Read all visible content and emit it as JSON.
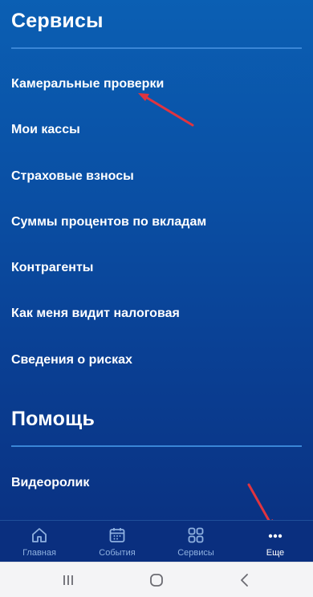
{
  "colors": {
    "background_top": "#0b5fb3",
    "background_bottom": "#0a2f7f",
    "divider": "#3a86d6",
    "tab_inactive": "#8fb1e0",
    "tab_active": "#ffffff",
    "annotation_arrow": "#e0343f"
  },
  "services": {
    "title": "Сервисы",
    "items": [
      {
        "label": "Камеральные проверки"
      },
      {
        "label": "Мои кассы"
      },
      {
        "label": "Страховые взносы"
      },
      {
        "label": "Суммы процентов по вкладам"
      },
      {
        "label": "Контрагенты"
      },
      {
        "label": "Как меня видит налоговая"
      },
      {
        "label": "Сведения о рисках"
      }
    ]
  },
  "help": {
    "title": "Помощь",
    "items": [
      {
        "label": "Видеоролик"
      }
    ]
  },
  "tabbar": {
    "tabs": [
      {
        "label": "Главная",
        "icon": "home-icon",
        "active": false
      },
      {
        "label": "События",
        "icon": "calendar-icon",
        "active": false
      },
      {
        "label": "Сервисы",
        "icon": "grid-icon",
        "active": false
      },
      {
        "label": "Еще",
        "icon": "more-dots-icon",
        "active": true
      }
    ]
  },
  "system_nav": {
    "buttons": [
      "recent-apps-icon",
      "home-circle-icon",
      "back-chevron-icon"
    ]
  }
}
